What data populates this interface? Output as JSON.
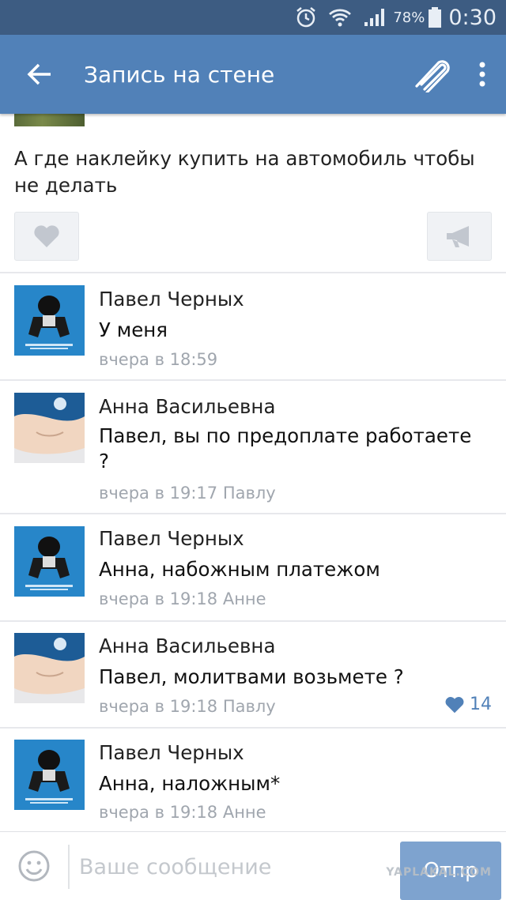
{
  "status_bar": {
    "battery": "78%",
    "time": "0:30"
  },
  "app_bar": {
    "title": "Запись на стене"
  },
  "post": {
    "text": "А где наклейку купить на автомобиль чтобы не делать"
  },
  "comments": [
    {
      "author": "Павел Черных",
      "text": "У меня",
      "time": "вчера в 18:59",
      "avatar": "pavel-avatar"
    },
    {
      "author": "Анна Васильевна",
      "text": "Павел, вы по предоплате работаете ?",
      "time": "вчера в 19:17 Павлу",
      "avatar": "anna-avatar"
    },
    {
      "author": "Павел Черных",
      "text": "Анна, набожным платежом",
      "time": "вчера в 19:18 Анне",
      "avatar": "pavel-avatar"
    },
    {
      "author": "Анна Васильевна",
      "text": "Павел, молитвами возьмете ?",
      "time": "вчера в 19:18 Павлу",
      "avatar": "anna-avatar",
      "likes": "14"
    },
    {
      "author": "Павел Черных",
      "text": "Анна, наложным*",
      "time": "вчера в 19:18 Анне",
      "avatar": "pavel-avatar"
    }
  ],
  "composer": {
    "placeholder": "Ваше сообщение",
    "send_label": "Отпр"
  },
  "watermark": "YAPLAKAL.COM",
  "colors": {
    "header": "#5181b8",
    "status_bar": "#3d5c82",
    "like": "#5181b8",
    "meta": "#a0a6ae"
  }
}
